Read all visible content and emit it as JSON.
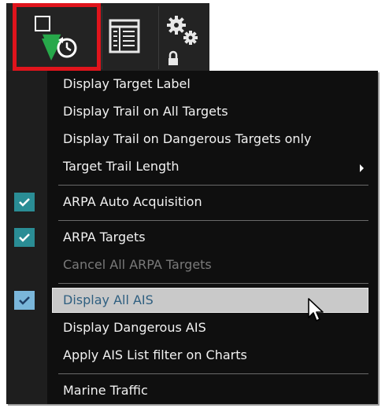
{
  "toolbar": {
    "buttons": [
      {
        "icon": "target-display-icon",
        "selected": true
      },
      {
        "icon": "list-table-icon",
        "selected": false
      },
      {
        "icon": "settings-lock-icon",
        "selected": false
      }
    ],
    "selected_outline_color": "#e0141c",
    "accent_check_color": "#2a8d95"
  },
  "menu": {
    "items": [
      {
        "label": "Display Target Label",
        "checked": false,
        "enabled": true
      },
      {
        "label": "Display Trail on All Targets",
        "checked": false,
        "enabled": true
      },
      {
        "label": "Display Trail on Dangerous Targets only",
        "checked": false,
        "enabled": true
      },
      {
        "label": "Target Trail Length",
        "checked": false,
        "enabled": true,
        "submenu": true
      },
      {
        "label": "ARPA Auto Acquisition",
        "checked": true,
        "enabled": true
      },
      {
        "label": "ARPA Targets",
        "checked": true,
        "enabled": true
      },
      {
        "label": "Cancel All ARPA Targets",
        "checked": false,
        "enabled": false
      },
      {
        "label": "Display All AIS",
        "checked": true,
        "enabled": true,
        "highlighted": true
      },
      {
        "label": "Display Dangerous AIS",
        "checked": false,
        "enabled": true
      },
      {
        "label": "Apply AIS List filter on Charts",
        "checked": false,
        "enabled": true
      },
      {
        "label": "Marine Traffic",
        "checked": false,
        "enabled": true
      }
    ]
  }
}
